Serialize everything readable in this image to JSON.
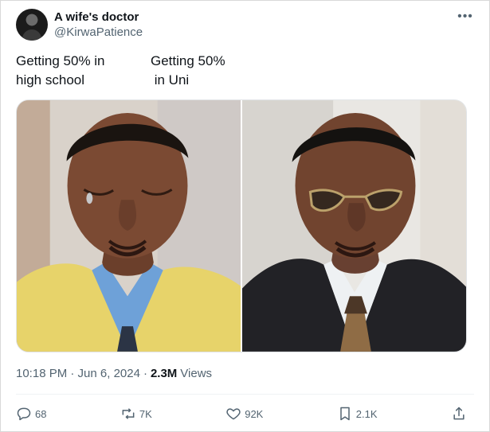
{
  "post": {
    "author_name": "A wife's doctor",
    "author_handle": "@KirwaPatience",
    "caption_left": "Getting 50% in\nhigh school",
    "caption_right": "Getting 50%\n in Uni",
    "timestamp": "10:18 PM · Jun 6, 2024",
    "views_separator": "·",
    "views_count": "2.3M",
    "views_label": "Views"
  },
  "actions": {
    "replies": "68",
    "reposts": "7K",
    "likes": "92K",
    "bookmarks": "2.1K"
  },
  "icons": {
    "menu": "more-icon",
    "reply": "reply-icon",
    "repost": "repost-icon",
    "like": "heart-icon",
    "bookmark": "bookmark-icon",
    "share": "share-icon"
  },
  "colors": {
    "text_primary": "#0f1419",
    "text_secondary": "#536471",
    "divider": "#eff3f4"
  }
}
